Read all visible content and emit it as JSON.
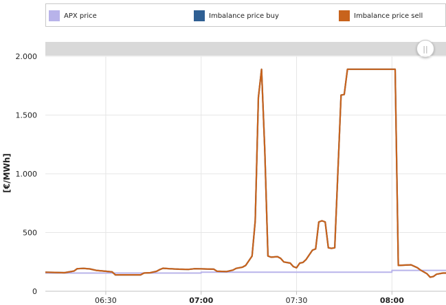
{
  "legend": {
    "items": [
      {
        "label": "APX price",
        "color": "#b8b3ea"
      },
      {
        "label": "Imbalance price buy",
        "color": "#2f5f93"
      },
      {
        "label": "Imbalance price sell",
        "color": "#c8631c"
      }
    ]
  },
  "navigator": {
    "handle_glyph": "||"
  },
  "chart_data": {
    "type": "line",
    "title": "",
    "xlabel": "",
    "ylabel": "[€/MWh]",
    "xlim": [
      "06:11",
      "08:17"
    ],
    "ylim": [
      0,
      2000
    ],
    "grid": true,
    "legend_position": "top",
    "x_ticks": [
      {
        "label": "06:30",
        "bold": false
      },
      {
        "label": "07:00",
        "bold": true
      },
      {
        "label": "07:30",
        "bold": false
      },
      {
        "label": "08:00",
        "bold": true
      }
    ],
    "y_ticks": [
      {
        "value": 0,
        "label": "0"
      },
      {
        "value": 500,
        "label": "500"
      },
      {
        "value": 1000,
        "label": "1.000"
      },
      {
        "value": 1500,
        "label": "1.500"
      },
      {
        "value": 2000,
        "label": "2.000"
      }
    ],
    "series": [
      {
        "name": "APX price",
        "color": "#b8b3ea",
        "step": true,
        "points": [
          [
            "06:11",
            155
          ],
          [
            "07:00",
            162
          ],
          [
            "08:00",
            178
          ],
          [
            "08:17",
            178
          ]
        ]
      },
      {
        "name": "Imbalance price buy",
        "color": "#2f5f93",
        "points": [
          [
            "06:11",
            162
          ],
          [
            "06:14",
            160
          ],
          [
            "06:17",
            158
          ],
          [
            "06:20",
            172
          ],
          [
            "06:21",
            192
          ],
          [
            "06:23",
            195
          ],
          [
            "06:25",
            190
          ],
          [
            "06:27",
            178
          ],
          [
            "06:30",
            170
          ],
          [
            "06:32",
            165
          ],
          [
            "06:33",
            140
          ],
          [
            "06:41",
            140
          ],
          [
            "06:42",
            155
          ],
          [
            "06:44",
            158
          ],
          [
            "06:46",
            170
          ],
          [
            "06:47",
            185
          ],
          [
            "06:48",
            196
          ],
          [
            "06:50",
            192
          ],
          [
            "06:53",
            188
          ],
          [
            "06:56",
            186
          ],
          [
            "06:58",
            192
          ],
          [
            "07:01",
            190
          ],
          [
            "07:04",
            188
          ],
          [
            "07:05",
            170
          ],
          [
            "07:08",
            168
          ],
          [
            "07:10",
            180
          ],
          [
            "07:11",
            195
          ],
          [
            "07:13",
            205
          ],
          [
            "07:14",
            220
          ],
          [
            "07:16",
            300
          ],
          [
            "07:17",
            600
          ],
          [
            "07:18",
            1650
          ],
          [
            "07:19",
            1890
          ],
          [
            "07:20",
            1200
          ],
          [
            "07:21",
            300
          ],
          [
            "07:22",
            290
          ],
          [
            "07:24",
            295
          ],
          [
            "07:25",
            280
          ],
          [
            "07:26",
            250
          ],
          [
            "07:28",
            240
          ],
          [
            "07:29",
            210
          ],
          [
            "07:30",
            200
          ],
          [
            "07:31",
            240
          ],
          [
            "07:32",
            245
          ],
          [
            "07:33",
            270
          ],
          [
            "07:35",
            350
          ],
          [
            "07:36",
            360
          ],
          [
            "07:37",
            590
          ],
          [
            "07:38",
            600
          ],
          [
            "07:39",
            590
          ],
          [
            "07:40",
            370
          ],
          [
            "07:41",
            365
          ],
          [
            "07:42",
            370
          ],
          [
            "07:44",
            1670
          ],
          [
            "07:45",
            1675
          ],
          [
            "07:46",
            1890
          ],
          [
            "07:48",
            1890
          ],
          [
            "08:01",
            1890
          ],
          [
            "08:02",
            220
          ],
          [
            "08:06",
            225
          ],
          [
            "08:08",
            200
          ],
          [
            "08:09",
            180
          ],
          [
            "08:11",
            150
          ],
          [
            "08:12",
            120
          ],
          [
            "08:13",
            125
          ],
          [
            "08:14",
            145
          ],
          [
            "08:16",
            155
          ],
          [
            "08:17",
            155
          ]
        ]
      },
      {
        "name": "Imbalance price sell",
        "color": "#c8631c",
        "points": [
          [
            "06:11",
            162
          ],
          [
            "06:14",
            160
          ],
          [
            "06:17",
            158
          ],
          [
            "06:20",
            172
          ],
          [
            "06:21",
            192
          ],
          [
            "06:23",
            195
          ],
          [
            "06:25",
            190
          ],
          [
            "06:27",
            178
          ],
          [
            "06:30",
            170
          ],
          [
            "06:32",
            165
          ],
          [
            "06:33",
            140
          ],
          [
            "06:41",
            140
          ],
          [
            "06:42",
            155
          ],
          [
            "06:44",
            158
          ],
          [
            "06:46",
            170
          ],
          [
            "06:47",
            185
          ],
          [
            "06:48",
            196
          ],
          [
            "06:50",
            192
          ],
          [
            "06:53",
            188
          ],
          [
            "06:56",
            186
          ],
          [
            "06:58",
            192
          ],
          [
            "07:01",
            190
          ],
          [
            "07:04",
            188
          ],
          [
            "07:05",
            170
          ],
          [
            "07:08",
            168
          ],
          [
            "07:10",
            180
          ],
          [
            "07:11",
            195
          ],
          [
            "07:13",
            205
          ],
          [
            "07:14",
            220
          ],
          [
            "07:16",
            300
          ],
          [
            "07:17",
            600
          ],
          [
            "07:18",
            1650
          ],
          [
            "07:19",
            1890
          ],
          [
            "07:20",
            1200
          ],
          [
            "07:21",
            300
          ],
          [
            "07:22",
            290
          ],
          [
            "07:24",
            295
          ],
          [
            "07:25",
            280
          ],
          [
            "07:26",
            250
          ],
          [
            "07:28",
            240
          ],
          [
            "07:29",
            210
          ],
          [
            "07:30",
            200
          ],
          [
            "07:31",
            240
          ],
          [
            "07:32",
            245
          ],
          [
            "07:33",
            270
          ],
          [
            "07:35",
            350
          ],
          [
            "07:36",
            360
          ],
          [
            "07:37",
            590
          ],
          [
            "07:38",
            600
          ],
          [
            "07:39",
            590
          ],
          [
            "07:40",
            370
          ],
          [
            "07:41",
            365
          ],
          [
            "07:42",
            370
          ],
          [
            "07:44",
            1670
          ],
          [
            "07:45",
            1675
          ],
          [
            "07:46",
            1890
          ],
          [
            "07:48",
            1890
          ],
          [
            "08:01",
            1890
          ],
          [
            "08:02",
            220
          ],
          [
            "08:06",
            225
          ],
          [
            "08:08",
            200
          ],
          [
            "08:09",
            180
          ],
          [
            "08:11",
            150
          ],
          [
            "08:12",
            120
          ],
          [
            "08:13",
            125
          ],
          [
            "08:14",
            145
          ],
          [
            "08:16",
            155
          ],
          [
            "08:17",
            155
          ]
        ]
      }
    ]
  }
}
